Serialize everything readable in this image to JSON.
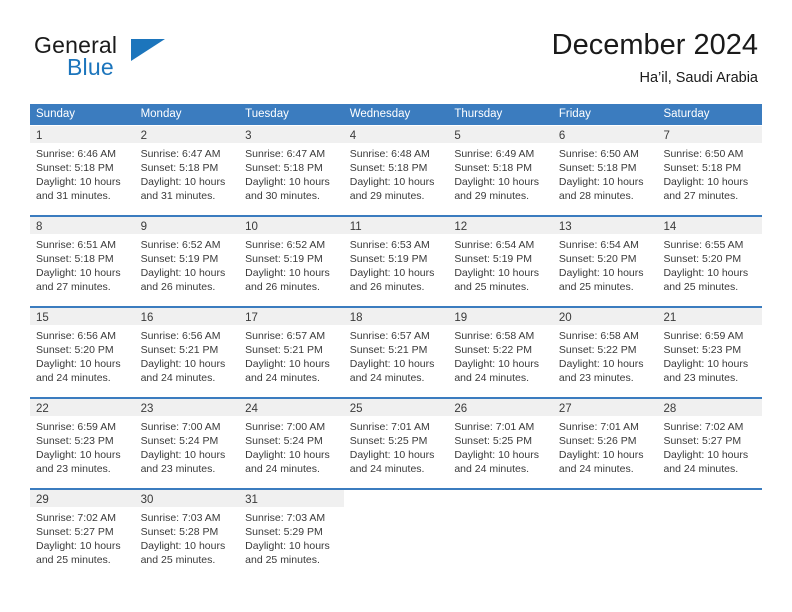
{
  "brand": {
    "name_top": "General",
    "name_bottom": "Blue",
    "triangle_icon": "brand-triangle-icon",
    "accent_color": "#1c75bc"
  },
  "header": {
    "title": "December 2024",
    "subtitle": "Ha’il, Saudi Arabia"
  },
  "theme": {
    "header_blue": "#3b7cbf",
    "daynum_strip": "#f0f0f0",
    "text": "#3a3a3a"
  },
  "calendar": {
    "weekday_headers": [
      "Sunday",
      "Monday",
      "Tuesday",
      "Wednesday",
      "Thursday",
      "Friday",
      "Saturday"
    ],
    "weeks": [
      [
        {
          "day": "1",
          "sunrise": "Sunrise: 6:46 AM",
          "sunset": "Sunset: 5:18 PM",
          "daylight_1": "Daylight: 10 hours",
          "daylight_2": "and 31 minutes."
        },
        {
          "day": "2",
          "sunrise": "Sunrise: 6:47 AM",
          "sunset": "Sunset: 5:18 PM",
          "daylight_1": "Daylight: 10 hours",
          "daylight_2": "and 31 minutes."
        },
        {
          "day": "3",
          "sunrise": "Sunrise: 6:47 AM",
          "sunset": "Sunset: 5:18 PM",
          "daylight_1": "Daylight: 10 hours",
          "daylight_2": "and 30 minutes."
        },
        {
          "day": "4",
          "sunrise": "Sunrise: 6:48 AM",
          "sunset": "Sunset: 5:18 PM",
          "daylight_1": "Daylight: 10 hours",
          "daylight_2": "and 29 minutes."
        },
        {
          "day": "5",
          "sunrise": "Sunrise: 6:49 AM",
          "sunset": "Sunset: 5:18 PM",
          "daylight_1": "Daylight: 10 hours",
          "daylight_2": "and 29 minutes."
        },
        {
          "day": "6",
          "sunrise": "Sunrise: 6:50 AM",
          "sunset": "Sunset: 5:18 PM",
          "daylight_1": "Daylight: 10 hours",
          "daylight_2": "and 28 minutes."
        },
        {
          "day": "7",
          "sunrise": "Sunrise: 6:50 AM",
          "sunset": "Sunset: 5:18 PM",
          "daylight_1": "Daylight: 10 hours",
          "daylight_2": "and 27 minutes."
        }
      ],
      [
        {
          "day": "8",
          "sunrise": "Sunrise: 6:51 AM",
          "sunset": "Sunset: 5:18 PM",
          "daylight_1": "Daylight: 10 hours",
          "daylight_2": "and 27 minutes."
        },
        {
          "day": "9",
          "sunrise": "Sunrise: 6:52 AM",
          "sunset": "Sunset: 5:19 PM",
          "daylight_1": "Daylight: 10 hours",
          "daylight_2": "and 26 minutes."
        },
        {
          "day": "10",
          "sunrise": "Sunrise: 6:52 AM",
          "sunset": "Sunset: 5:19 PM",
          "daylight_1": "Daylight: 10 hours",
          "daylight_2": "and 26 minutes."
        },
        {
          "day": "11",
          "sunrise": "Sunrise: 6:53 AM",
          "sunset": "Sunset: 5:19 PM",
          "daylight_1": "Daylight: 10 hours",
          "daylight_2": "and 26 minutes."
        },
        {
          "day": "12",
          "sunrise": "Sunrise: 6:54 AM",
          "sunset": "Sunset: 5:19 PM",
          "daylight_1": "Daylight: 10 hours",
          "daylight_2": "and 25 minutes."
        },
        {
          "day": "13",
          "sunrise": "Sunrise: 6:54 AM",
          "sunset": "Sunset: 5:20 PM",
          "daylight_1": "Daylight: 10 hours",
          "daylight_2": "and 25 minutes."
        },
        {
          "day": "14",
          "sunrise": "Sunrise: 6:55 AM",
          "sunset": "Sunset: 5:20 PM",
          "daylight_1": "Daylight: 10 hours",
          "daylight_2": "and 25 minutes."
        }
      ],
      [
        {
          "day": "15",
          "sunrise": "Sunrise: 6:56 AM",
          "sunset": "Sunset: 5:20 PM",
          "daylight_1": "Daylight: 10 hours",
          "daylight_2": "and 24 minutes."
        },
        {
          "day": "16",
          "sunrise": "Sunrise: 6:56 AM",
          "sunset": "Sunset: 5:21 PM",
          "daylight_1": "Daylight: 10 hours",
          "daylight_2": "and 24 minutes."
        },
        {
          "day": "17",
          "sunrise": "Sunrise: 6:57 AM",
          "sunset": "Sunset: 5:21 PM",
          "daylight_1": "Daylight: 10 hours",
          "daylight_2": "and 24 minutes."
        },
        {
          "day": "18",
          "sunrise": "Sunrise: 6:57 AM",
          "sunset": "Sunset: 5:21 PM",
          "daylight_1": "Daylight: 10 hours",
          "daylight_2": "and 24 minutes."
        },
        {
          "day": "19",
          "sunrise": "Sunrise: 6:58 AM",
          "sunset": "Sunset: 5:22 PM",
          "daylight_1": "Daylight: 10 hours",
          "daylight_2": "and 24 minutes."
        },
        {
          "day": "20",
          "sunrise": "Sunrise: 6:58 AM",
          "sunset": "Sunset: 5:22 PM",
          "daylight_1": "Daylight: 10 hours",
          "daylight_2": "and 23 minutes."
        },
        {
          "day": "21",
          "sunrise": "Sunrise: 6:59 AM",
          "sunset": "Sunset: 5:23 PM",
          "daylight_1": "Daylight: 10 hours",
          "daylight_2": "and 23 minutes."
        }
      ],
      [
        {
          "day": "22",
          "sunrise": "Sunrise: 6:59 AM",
          "sunset": "Sunset: 5:23 PM",
          "daylight_1": "Daylight: 10 hours",
          "daylight_2": "and 23 minutes."
        },
        {
          "day": "23",
          "sunrise": "Sunrise: 7:00 AM",
          "sunset": "Sunset: 5:24 PM",
          "daylight_1": "Daylight: 10 hours",
          "daylight_2": "and 23 minutes."
        },
        {
          "day": "24",
          "sunrise": "Sunrise: 7:00 AM",
          "sunset": "Sunset: 5:24 PM",
          "daylight_1": "Daylight: 10 hours",
          "daylight_2": "and 24 minutes."
        },
        {
          "day": "25",
          "sunrise": "Sunrise: 7:01 AM",
          "sunset": "Sunset: 5:25 PM",
          "daylight_1": "Daylight: 10 hours",
          "daylight_2": "and 24 minutes."
        },
        {
          "day": "26",
          "sunrise": "Sunrise: 7:01 AM",
          "sunset": "Sunset: 5:25 PM",
          "daylight_1": "Daylight: 10 hours",
          "daylight_2": "and 24 minutes."
        },
        {
          "day": "27",
          "sunrise": "Sunrise: 7:01 AM",
          "sunset": "Sunset: 5:26 PM",
          "daylight_1": "Daylight: 10 hours",
          "daylight_2": "and 24 minutes."
        },
        {
          "day": "28",
          "sunrise": "Sunrise: 7:02 AM",
          "sunset": "Sunset: 5:27 PM",
          "daylight_1": "Daylight: 10 hours",
          "daylight_2": "and 24 minutes."
        }
      ],
      [
        {
          "day": "29",
          "sunrise": "Sunrise: 7:02 AM",
          "sunset": "Sunset: 5:27 PM",
          "daylight_1": "Daylight: 10 hours",
          "daylight_2": "and 25 minutes."
        },
        {
          "day": "30",
          "sunrise": "Sunrise: 7:03 AM",
          "sunset": "Sunset: 5:28 PM",
          "daylight_1": "Daylight: 10 hours",
          "daylight_2": "and 25 minutes."
        },
        {
          "day": "31",
          "sunrise": "Sunrise: 7:03 AM",
          "sunset": "Sunset: 5:29 PM",
          "daylight_1": "Daylight: 10 hours",
          "daylight_2": "and 25 minutes."
        },
        null,
        null,
        null,
        null
      ]
    ]
  }
}
